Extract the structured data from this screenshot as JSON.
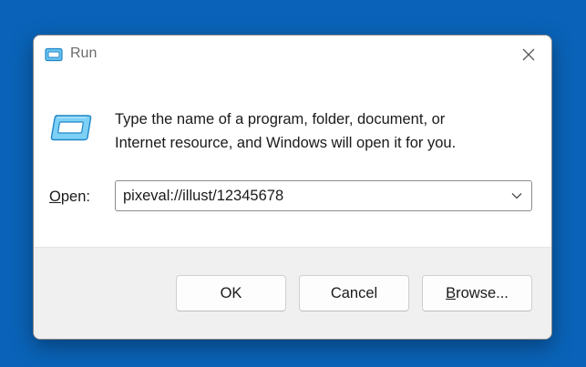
{
  "window": {
    "title": "Run",
    "title_icon": "run-icon",
    "close_icon": "close-icon"
  },
  "content": {
    "description_line1": "Type the name of a program, folder, document, or",
    "description_line2": "Internet resource, and Windows will open it for you.",
    "icon": "run-icon"
  },
  "open": {
    "label_accel": "O",
    "label_rest": "pen:",
    "value": "pixeval://illust/12345678",
    "dropdown_icon": "chevron-down-icon"
  },
  "buttons": {
    "ok": "OK",
    "cancel": "Cancel",
    "browse_accel": "B",
    "browse_rest": "rowse..."
  },
  "colors": {
    "desktop": "#0a63b8",
    "dialog": "#ffffff",
    "footer": "#f0f0f0",
    "icon_accent": "#29a8e8"
  }
}
